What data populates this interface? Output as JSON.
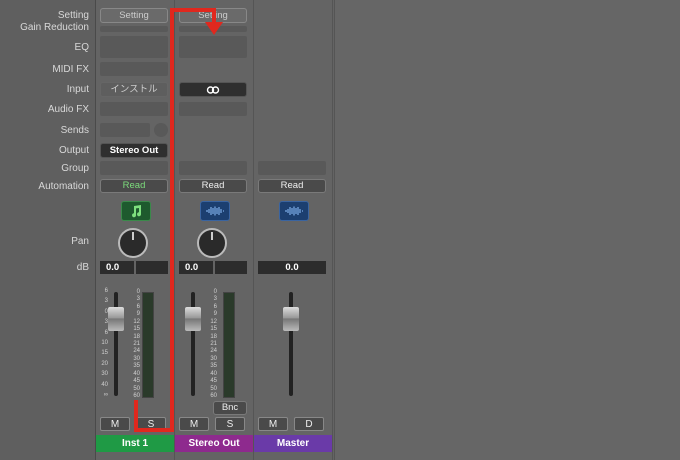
{
  "row_labels": {
    "setting": "Setting",
    "gain_reduction": "Gain Reduction",
    "eq": "EQ",
    "midi_fx": "MIDI FX",
    "input": "Input",
    "audio_fx": "Audio FX",
    "sends": "Sends",
    "output": "Output",
    "group": "Group",
    "automation": "Automation",
    "pan": "Pan",
    "db": "dB"
  },
  "fader_scale_left": [
    "6",
    "3",
    "0",
    "3",
    "6",
    "10",
    "15",
    "20",
    "30",
    "40",
    "∞"
  ],
  "meter_scale": [
    "0",
    "3",
    "6",
    "9",
    "12",
    "15",
    "18",
    "21",
    "24",
    "30",
    "35",
    "40",
    "45",
    "50",
    "60"
  ],
  "channels": {
    "inst1": {
      "setting": "Setting",
      "input": "インストル",
      "output": "Stereo Out",
      "automation": "Read",
      "volume": "0.0",
      "mute": "M",
      "solo": "S",
      "name": "Inst 1",
      "icon": "music-note-icon",
      "color": "#1f9a45"
    },
    "stereo_out": {
      "setting": "Setting",
      "input_icon": "stereo-link-icon",
      "automation": "Read",
      "volume": "0.0",
      "bounce": "Bnc",
      "mute": "M",
      "solo": "S",
      "name": "Stereo Out",
      "icon": "waveform-icon",
      "color": "#8e2a8e"
    },
    "master": {
      "automation": "Read",
      "volume": "0.0",
      "mute": "M",
      "dim": "D",
      "name": "Master",
      "icon": "waveform-icon",
      "color": "#6a3aa8"
    }
  },
  "annotation_color": "#e0281e"
}
